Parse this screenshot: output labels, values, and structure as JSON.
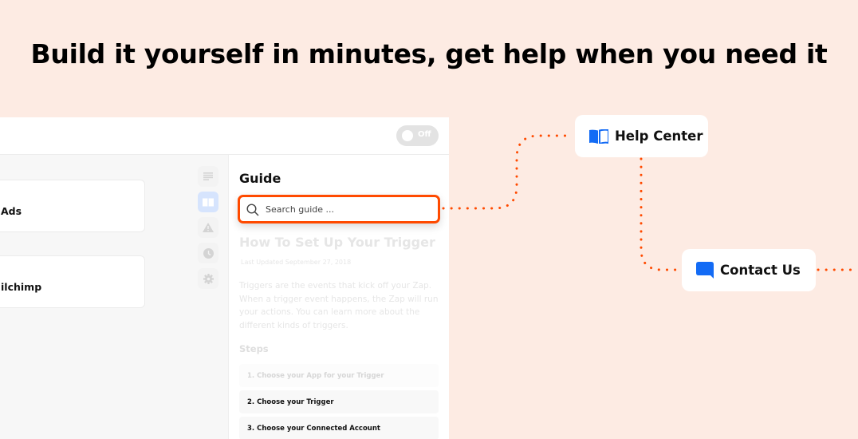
{
  "headline": "Build it yourself in minutes, get help when you need it",
  "app": {
    "toggle": {
      "label": "Off",
      "state": "off"
    },
    "steps": [
      {
        "name": "Ads"
      },
      {
        "name": "ilchimp"
      }
    ],
    "rail": [
      {
        "icon": "list-icon",
        "active": false
      },
      {
        "icon": "book-icon",
        "active": true
      },
      {
        "icon": "warning-icon",
        "active": false
      },
      {
        "icon": "clock-icon",
        "active": false
      },
      {
        "icon": "gear-icon",
        "active": false
      }
    ],
    "guide": {
      "title": "Guide",
      "search_placeholder": "Search guide ...",
      "article_title": "How To Set Up Your Trigger",
      "last_updated": "Last Updated September 27, 2018",
      "body": "Triggers are the events that kick off your Zap. When a trigger event happens, the Zap will run your actions. You can learn more about the different kinds of triggers.",
      "steps_heading": "Steps",
      "steps": [
        "1. Choose your App for your Trigger",
        "2. Choose your Trigger",
        "3. Choose your Connected Account"
      ]
    }
  },
  "help": {
    "help_center": {
      "label": "Help Center",
      "icon": "book-icon"
    },
    "contact_us": {
      "label": "Contact Us",
      "icon": "chat-bubble-icon"
    }
  },
  "colors": {
    "background": "#fdebe3",
    "accent": "#ff4a00",
    "icon_blue": "#136bf5"
  }
}
